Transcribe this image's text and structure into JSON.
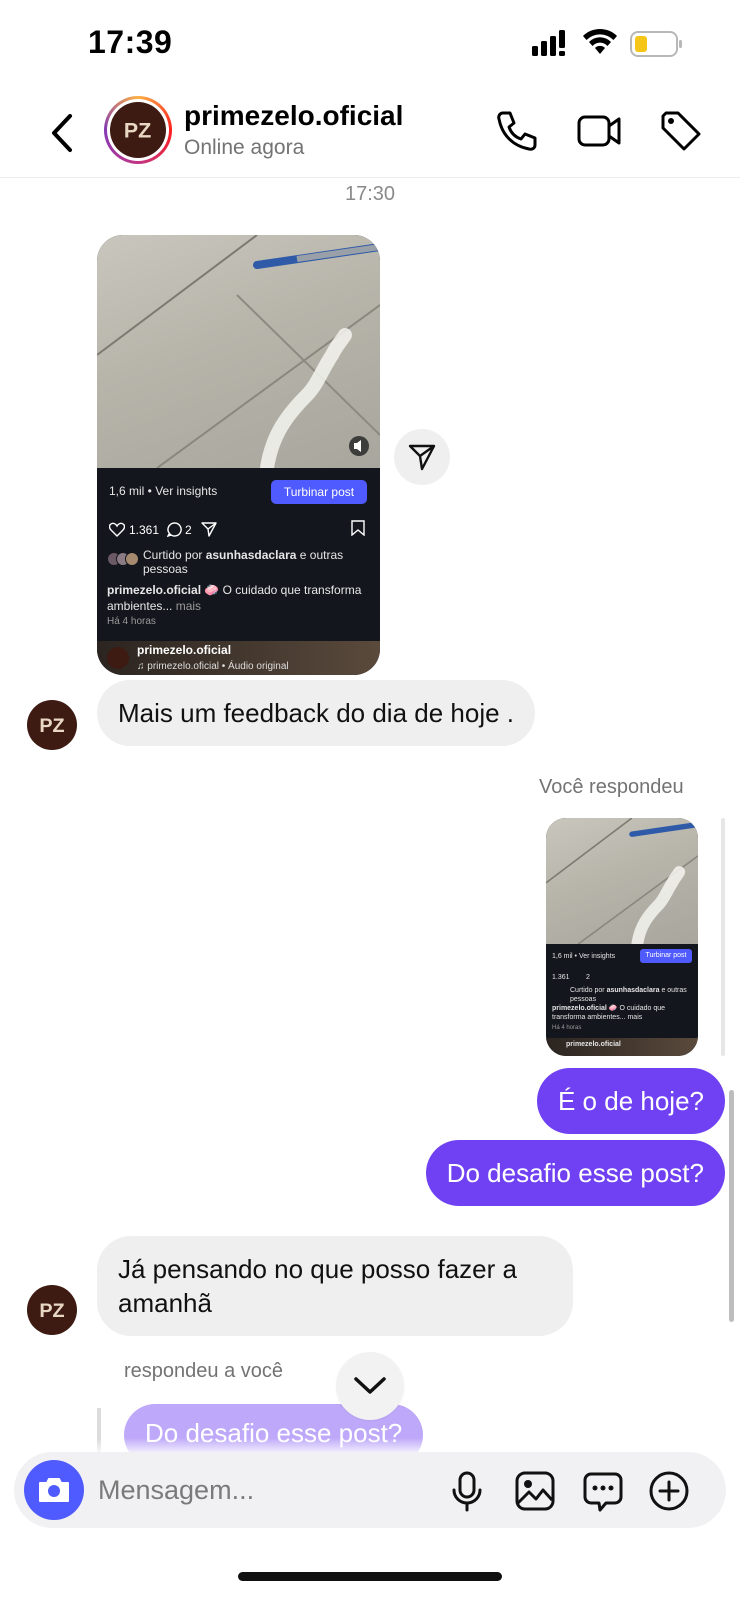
{
  "status_bar": {
    "time": "17:39"
  },
  "header": {
    "username": "primezelo.oficial",
    "presence": "Online agora",
    "avatar_text": "PZ"
  },
  "thread": {
    "timestamp": "17:30",
    "shared_reel": {
      "views_text": "1,6 mil • Ver insights",
      "boost_label": "Turbinar post",
      "likes": "1.361",
      "comments": "2",
      "liked_by_prefix": "Curtido por ",
      "liked_by_user": "asunhasdaclara",
      "liked_by_suffix": " e outras pessoas",
      "caption_user": "primezelo.oficial",
      "caption_text": " 🧼 O cuidado que transforma ambientes...",
      "caption_more": " mais",
      "posted_ago": "Há 4 horas",
      "author": "primezelo.oficial",
      "audio": "♫ primezelo.oficial • Áudio original"
    },
    "messages": [
      {
        "side": "in",
        "text": "Mais um feedback do dia de hoje ."
      },
      {
        "side": "out",
        "text": "É o de hoje?"
      },
      {
        "side": "out",
        "text": "Do desafio esse post?"
      },
      {
        "side": "in",
        "text": "Já pensando no que posso fazer a amanhã"
      },
      {
        "side": "in",
        "text": "Do desafio esse post?"
      }
    ],
    "you_replied_label": "Você respondeu",
    "replied_to_you_label": "respondeu a você"
  },
  "composer": {
    "placeholder": "Mensagem..."
  },
  "colors": {
    "outgoing_bubble": "#7041f2",
    "incoming_bubble": "#efefef",
    "camera_button": "#4f5bff",
    "boost_button": "#4f5bff"
  }
}
